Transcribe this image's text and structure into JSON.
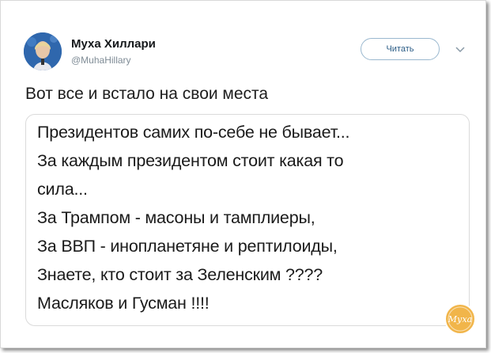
{
  "author": {
    "name": "Муха Хиллари",
    "handle": "@MuhaHillary"
  },
  "follow_button": {
    "label": "Читать"
  },
  "tweet": {
    "text": "Вот все и встало на свои места"
  },
  "media": {
    "lines": [
      "Президентов самих по-себе не бывает...",
      "За каждым президентом стоит какая то",
      "сила...",
      "За Трампом - масоны и тамплиеры,",
      "За ВВП - инопланетяне и рептилоиды,",
      "Знаете, кто стоит за Зеленским ????",
      "Масляков и Гусман !!!!"
    ]
  },
  "watermark": {
    "text": "Муха",
    "color": "#e8a13a"
  },
  "icons": [
    "avatar",
    "chevron-down-icon",
    "watermark-logo"
  ]
}
